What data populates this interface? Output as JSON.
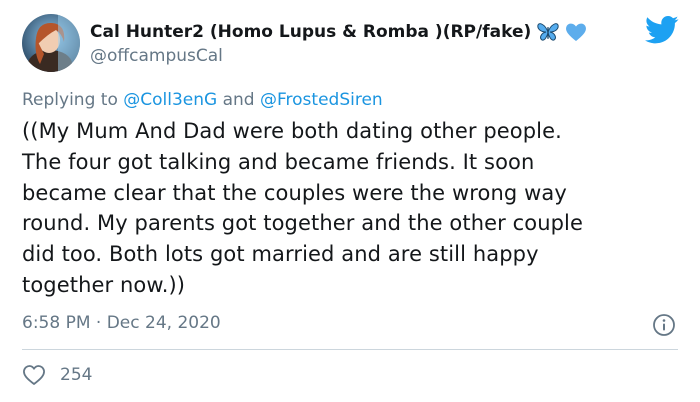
{
  "author": {
    "display_name": "Cal Hunter2 (Homo Lupus & Romba )(RP/fake)",
    "handle": "@offcampusCal",
    "emojis": [
      "butterfly-icon",
      "blue-heart-icon"
    ]
  },
  "reply": {
    "prefix": "Replying to",
    "mention1": "@Coll3enG",
    "conjunction": "and",
    "mention2": "@FrostedSiren"
  },
  "tweet": {
    "lines": [
      "((My Mum And Dad were both dating other people.",
      "The four got talking and became friends. It soon",
      "became clear that the couples were the wrong way",
      "round. My parents got together and the other couple",
      "did too. Both lots got married and are still happy",
      "together now.))"
    ],
    "time": "6:58 PM",
    "separator": "·",
    "date": "Dec 24, 2020"
  },
  "engagement": {
    "likes": "254"
  },
  "colors": {
    "twitter_blue": "#1da1f2",
    "mention_blue": "#1b95e0",
    "muted_gray": "#657786",
    "divider": "#ccd6dd"
  },
  "icons": {
    "logo": "twitter-bird-icon",
    "info": "info-icon",
    "like": "heart-icon"
  }
}
